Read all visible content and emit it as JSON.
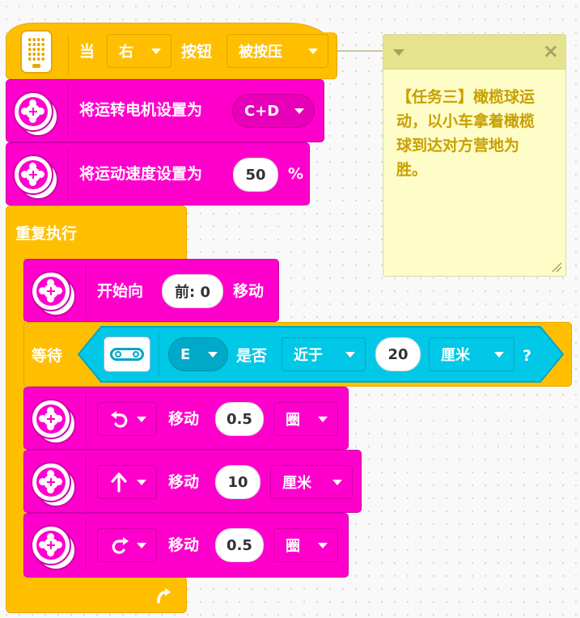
{
  "hat_block": {
    "when": "当",
    "button_side": "右",
    "button_word": "按钮",
    "button_state": "被按压"
  },
  "set_motors": {
    "label": "将运转电机设置为",
    "value": "C+D"
  },
  "set_speed": {
    "label": "将运动速度设置为",
    "value": "50",
    "unit": "%"
  },
  "repeat": {
    "label": "重复执行"
  },
  "start_move": {
    "label": "开始向",
    "direction": "前: 0",
    "label2": "移动"
  },
  "wait": {
    "label": "等待",
    "port": "E",
    "is_label": "是否",
    "compare": "近于",
    "distance": "20",
    "unit": "厘米",
    "question": "?"
  },
  "move_blocks": [
    {
      "direction_icon": "turn-left-icon",
      "label": "移动",
      "amount": "0.5",
      "unit": "圈"
    },
    {
      "direction_icon": "arrow-up-icon",
      "label": "移动",
      "amount": "10",
      "unit": "厘米"
    },
    {
      "direction_icon": "turn-right-icon",
      "label": "移动",
      "amount": "0.5",
      "unit": "圈"
    }
  ],
  "comment": {
    "text": "【任务三】橄榄球运动，以小车拿着橄榄球到达对方营地为胜。",
    "close": "×"
  },
  "colors": {
    "event_yellow": "#ffbf00",
    "motor_magenta": "#ff00cc",
    "sensor_cyan": "#00c8e6",
    "comment_bg": "#fefdc8",
    "comment_header": "#e5e38e",
    "comment_text": "#c8a000"
  }
}
